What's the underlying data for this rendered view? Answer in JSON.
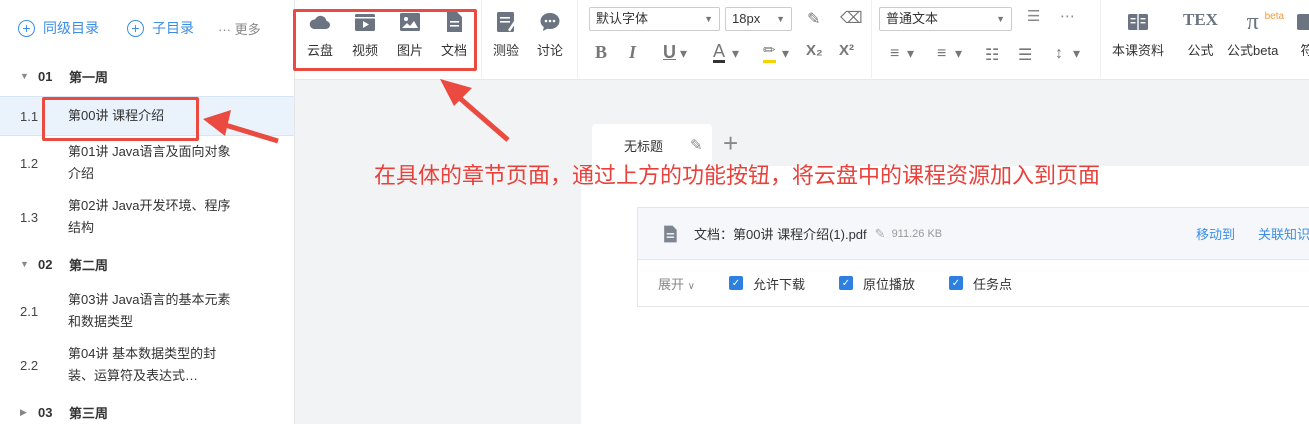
{
  "sidebar": {
    "btn_sibling": "同级目录",
    "btn_child": "子目录",
    "more": "··· 更多",
    "chapters": [
      {
        "num": "01",
        "title": "第一周"
      },
      {
        "num": "02",
        "title": "第二周"
      },
      {
        "num": "03",
        "title": "第三周"
      }
    ],
    "lessons": [
      {
        "num": "1.1",
        "title": "第00讲 课程介绍"
      },
      {
        "num": "1.2",
        "title": "第01讲 Java语言及面向对象介绍"
      },
      {
        "num": "1.3",
        "title": "第02讲 Java开发环境、程序结构"
      },
      {
        "num": "2.1",
        "title": "第03讲 Java语言的基本元素和数据类型"
      },
      {
        "num": "2.2",
        "title": "第04讲 基本数据类型的封装、运算符及表达式…"
      }
    ]
  },
  "toolbar": {
    "cloud": "云盘",
    "video": "视频",
    "image": "图片",
    "doc": "文档",
    "quiz": "测验",
    "discuss": "讨论",
    "font_family": "默认字体",
    "font_size": "18px",
    "para_style": "普通文本",
    "course_material": "本课资料",
    "formula": "公式",
    "formula_beta": "公式beta",
    "beta_tag": "beta",
    "cut": "符",
    "tex": "TEX",
    "pi": "π"
  },
  "editor": {
    "tab_title": "无标题",
    "doc_label": "文档：第00讲 课程介绍(1).pdf",
    "doc_size": "911.26 KB",
    "move_to": "移动到",
    "link_knowledge": "关联知识",
    "expand": "展开",
    "opt_download": "允许下载",
    "opt_inplace": "原位播放",
    "opt_task": "任务点"
  },
  "annotation": {
    "note": "在具体的章节页面，通过上方的功能按钮，将云盘中的课程资源加入到页面"
  }
}
